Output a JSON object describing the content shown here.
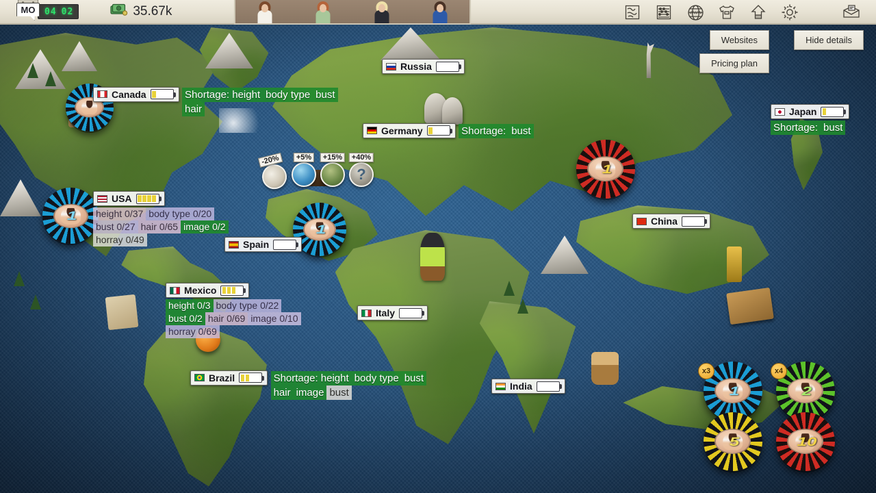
{
  "topbar": {
    "calendar_day": "MO",
    "clock_hours": "04",
    "clock_minutes": "02",
    "money": "35.67k",
    "money_icon": "money-stack-icon",
    "icons": [
      {
        "name": "map-icon",
        "glyph": "map"
      },
      {
        "name": "abacus-icon",
        "glyph": "abacus"
      },
      {
        "name": "www-globe-icon",
        "glyph": "www"
      },
      {
        "name": "tshirt-icon",
        "glyph": "tshirt"
      },
      {
        "name": "upload-icon",
        "glyph": "upload"
      },
      {
        "name": "gear-icon",
        "glyph": "gear"
      },
      {
        "name": "mailbox-icon",
        "glyph": "mail"
      }
    ],
    "portraits": [
      {
        "name": "portrait-1",
        "hair": "#7c4a2c",
        "outfit": "#f4f1ea"
      },
      {
        "name": "portrait-2",
        "hair": "#b5643a",
        "outfit": "#a8c79a"
      },
      {
        "name": "portrait-3",
        "hair": "#efe0a8",
        "outfit": "#2a2b33"
      },
      {
        "name": "portrait-4",
        "hair": "#4a3326",
        "outfit": "#2d5aa8"
      }
    ]
  },
  "buttons": {
    "websites": "Websites",
    "hide_details": "Hide details",
    "pricing_plan": "Pricing plan"
  },
  "countries": [
    {
      "id": "canada",
      "name": "Canada",
      "pips": 1,
      "flag": "canada-flag",
      "shortage": [
        "Shortage: height",
        "body type",
        "bust",
        "hair"
      ],
      "stats": []
    },
    {
      "id": "usa",
      "name": "USA",
      "pips": 4,
      "flag": "usa-flag",
      "shortage": [],
      "stats": [
        {
          "label": "height 0/37",
          "tone": "pink"
        },
        {
          "label": "body type 0/20",
          "tone": "violet"
        },
        {
          "label": "bust 0/27",
          "tone": "lilac"
        },
        {
          "label": "hair 0/65",
          "tone": "pink"
        },
        {
          "label": "image 0/2",
          "tone": "green"
        },
        {
          "label": "horray 0/49",
          "tone": "gray"
        }
      ]
    },
    {
      "id": "mexico",
      "name": "Mexico",
      "pips": 3,
      "flag": "mexico-flag",
      "shortage": [],
      "stats": [
        {
          "label": "height 0/3",
          "tone": "green"
        },
        {
          "label": "body type 0/22",
          "tone": "violet"
        },
        {
          "label": "bust 0/2",
          "tone": "green"
        },
        {
          "label": "hair 0/69",
          "tone": "pink"
        },
        {
          "label": "image 0/10",
          "tone": "lilac"
        },
        {
          "label": "horray 0/69",
          "tone": "violet"
        }
      ]
    },
    {
      "id": "brazil",
      "name": "Brazil",
      "pips": 2,
      "flag": "brazil-flag",
      "shortage": [
        "Shortage: height",
        "body type",
        "bust",
        "hair",
        "image",
        "bust"
      ],
      "shortage_pale_index": 5,
      "stats": []
    },
    {
      "id": "russia",
      "name": "Russia",
      "pips": 0,
      "flag": "russia-flag",
      "shortage": [],
      "stats": []
    },
    {
      "id": "germany",
      "name": "Germany",
      "pips": 1,
      "flag": "germany-flag",
      "shortage": [
        "Shortage:",
        "bust"
      ],
      "stats": []
    },
    {
      "id": "spain",
      "name": "Spain",
      "pips": 0,
      "flag": "spain-flag",
      "shortage": [],
      "stats": []
    },
    {
      "id": "italy",
      "name": "Italy",
      "pips": 0,
      "flag": "italy-flag",
      "shortage": [],
      "stats": []
    },
    {
      "id": "india",
      "name": "India",
      "pips": 0,
      "flag": "india-flag",
      "shortage": [],
      "stats": []
    },
    {
      "id": "china",
      "name": "China",
      "pips": 0,
      "flag": "china-flag",
      "shortage": [],
      "stats": []
    },
    {
      "id": "japan",
      "name": "Japan",
      "pips": 1,
      "flag": "japan-flag",
      "shortage": [
        "Shortage:",
        "bust"
      ],
      "stats": []
    }
  ],
  "bonus_badges": [
    {
      "id": "badge-minus20",
      "pct": "-20%",
      "icon": "bed-icon"
    },
    {
      "id": "badge-plus5",
      "pct": "+5%",
      "icon": "pool-icon"
    },
    {
      "id": "badge-plus15",
      "pct": "+15%",
      "icon": "house-icon"
    },
    {
      "id": "badge-plus40",
      "pct": "+40%",
      "icon": "question-icon"
    }
  ],
  "tray_chips": [
    {
      "id": "chip-1",
      "value": "1",
      "multiplier": "x3",
      "color": "#1b9dd4",
      "alt": "#11131a",
      "num_color": "#7fd9f5"
    },
    {
      "id": "chip-2",
      "value": "2",
      "multiplier": "x4",
      "color": "#5cc22a",
      "alt": "#11131a",
      "num_color": "#a8ef6a"
    },
    {
      "id": "chip-5",
      "value": "5",
      "multiplier": "",
      "color": "#e3c81f",
      "alt": "#11131a",
      "num_color": "#f4e25c"
    },
    {
      "id": "chip-10",
      "value": "10",
      "multiplier": "",
      "color": "#cf2b23",
      "alt": "#18100f",
      "num_color": "#f3d347"
    }
  ],
  "map_chips": [
    {
      "id": "map-chip-canada",
      "color": "#1b9dd4",
      "value": ""
    },
    {
      "id": "map-chip-usa",
      "color": "#1b9dd4",
      "value": "1"
    },
    {
      "id": "map-chip-spain",
      "color": "#1b9dd4",
      "value": "1"
    },
    {
      "id": "map-chip-asia",
      "color": "#cf2b23",
      "value": "1"
    }
  ],
  "colors": {
    "ocean": "#27547f",
    "land": "#6d8a46",
    "shortage_green": "#1f8a2e",
    "panel_cream": "#e6e1d2",
    "lcd_green": "#2fe06a"
  }
}
